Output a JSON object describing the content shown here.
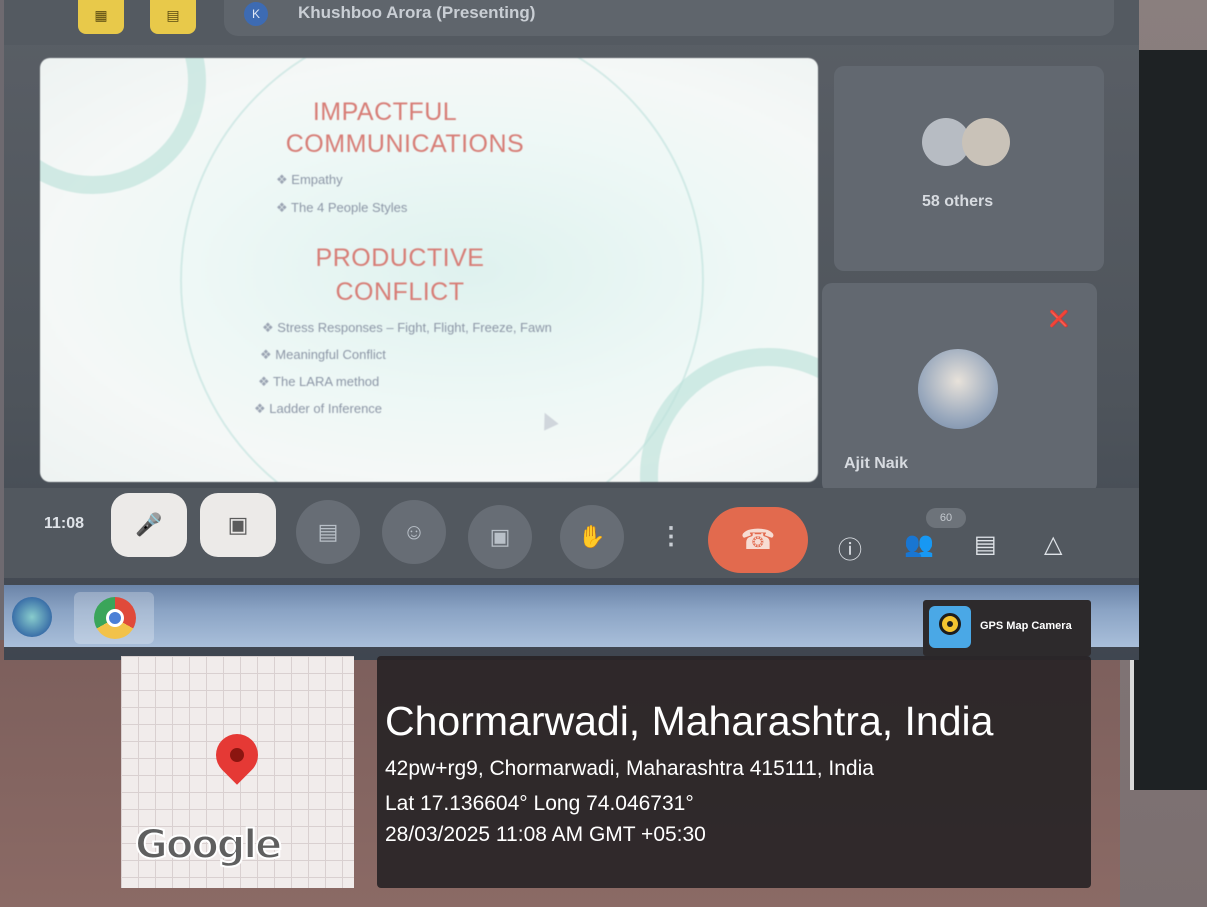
{
  "meeting": {
    "presenter_initial": "K",
    "presenter_label": "Khushboo Arora (Presenting)",
    "clock": "11:08"
  },
  "slide": {
    "heading1": "IMPACTFUL COMMUNICATIONS",
    "heading1_line1": "IMPACTFUL",
    "heading1_line2": "COMMUNICATIONS",
    "bullets1": [
      "Empathy",
      "The 4 People Styles"
    ],
    "heading2_line1": "PRODUCTIVE",
    "heading2_line2": "CONFLICT",
    "bullets2": [
      "Stress Responses – Fight, Flight, Freeze, Fawn",
      "Meaningful Conflict",
      "The LARA method",
      "Ladder of Inference"
    ]
  },
  "participants": {
    "others_label": "58 others",
    "tile2_name": "Ajit Naik",
    "people_count": "60"
  },
  "controls": {
    "mic_icon": "mic-off-icon",
    "camera_icon": "camera-off-icon",
    "captions_icon": "captions-icon",
    "emoji_icon": "emoji-icon",
    "present_icon": "present-screen-icon",
    "hand_icon": "raise-hand-icon",
    "more_icon": "more-vert-icon",
    "end_icon": "end-call-icon",
    "info_icon": "info-icon",
    "people_icon": "people-icon",
    "chat_icon": "chat-icon",
    "activities_icon": "activities-icon",
    "end_color": "#e26a4e"
  },
  "gps": {
    "badge_label": "GPS Map Camera",
    "map_brand": "Google",
    "place": "Chormarwadi, Maharashtra, India",
    "address": "42pw+rg9, Chormarwadi, Maharashtra 415111, India",
    "latlong": "Lat 17.136604° Long 74.046731°",
    "datetime": "28/03/2025 11:08 AM GMT +05:30",
    "pin_color": "#e53935"
  }
}
